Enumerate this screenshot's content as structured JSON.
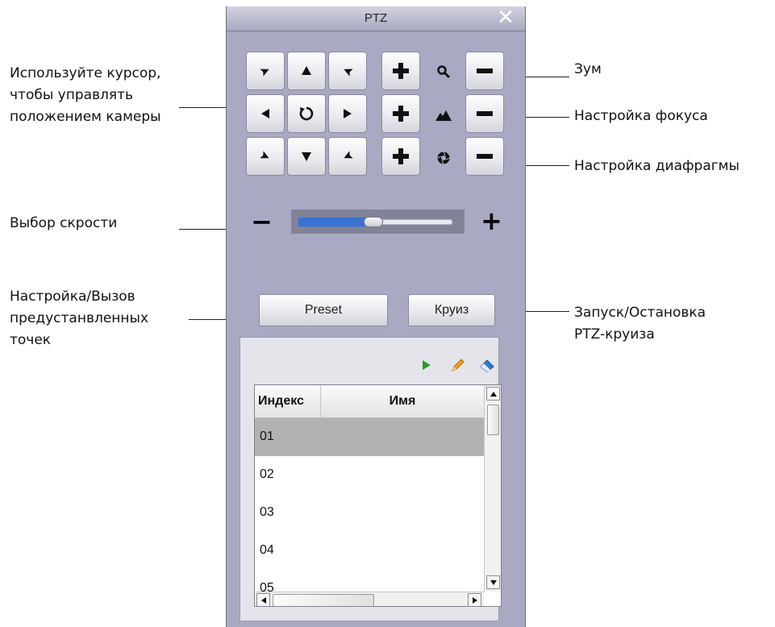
{
  "callouts": {
    "cursor": "Используйте курсор,\nчтобы управлять\nположением камеры",
    "zoom": "Зум",
    "focus": "Настройка фокуса",
    "iris": "Настройка диафрагмы",
    "speed": "Выбор скрости",
    "preset": "Настройка/Вызов\nпредустанвленных\nточек",
    "cruise": "Запуск/Остановка\nPTZ-круиза"
  },
  "window": {
    "title": "PTZ",
    "close_icon": "close-icon"
  },
  "direction_pad": [
    {
      "name": "up-left",
      "icon": "arrow-up-left-icon"
    },
    {
      "name": "up",
      "icon": "arrow-up-icon"
    },
    {
      "name": "up-right",
      "icon": "arrow-up-right-icon"
    },
    {
      "name": "left",
      "icon": "arrow-left-icon"
    },
    {
      "name": "auto-rotate",
      "icon": "rotate-icon"
    },
    {
      "name": "right",
      "icon": "arrow-right-icon"
    },
    {
      "name": "down-left",
      "icon": "arrow-down-left-icon"
    },
    {
      "name": "down",
      "icon": "arrow-down-icon"
    },
    {
      "name": "down-right",
      "icon": "arrow-down-right-icon"
    }
  ],
  "lens_controls": [
    {
      "name": "zoom",
      "icon": "magnifier-icon"
    },
    {
      "name": "focus",
      "icon": "mountain-icon"
    },
    {
      "name": "iris",
      "icon": "aperture-icon"
    }
  ],
  "speed": {
    "minus": "−",
    "plus": "+",
    "level": 0.45
  },
  "buttons": {
    "preset": "Preset",
    "cruise": "Круиз"
  },
  "toolbar": {
    "icons": [
      "play-icon",
      "pencil-icon",
      "eraser-icon"
    ]
  },
  "table": {
    "headers": [
      "Индекс",
      "Имя"
    ],
    "rows": [
      "01",
      "02",
      "03",
      "04",
      "05"
    ],
    "selected_row": 0
  },
  "colors": {
    "panel_bg": "#a9a9c3",
    "selected_row": "#b2b2b2",
    "speed_fill": "#3a72d2",
    "play_icon": "#2e9a2e",
    "pencil_icon": "#f0a020",
    "eraser_icon": "#2a7fd6"
  }
}
